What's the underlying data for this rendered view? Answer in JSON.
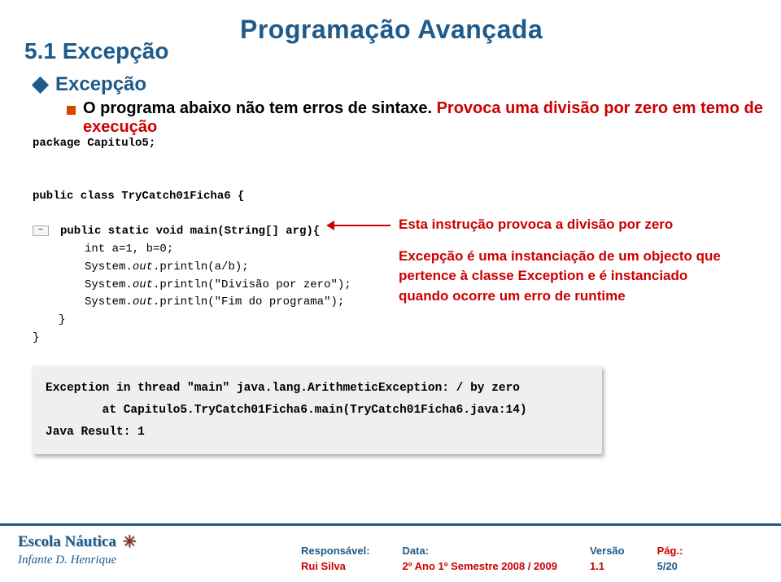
{
  "header": {
    "main_title": "Programação Avançada",
    "section_title": "5.1 Excepção",
    "sub_title": "Excepção",
    "body_part1": "O programa abaixo não tem erros de sintaxe. ",
    "body_part2": "Provoca uma divisão por zero em temo de execução"
  },
  "code": {
    "l1": "package Capitulo5;",
    "l2": "",
    "l3": "",
    "l4": "public class TryCatch01Ficha6 {",
    "l5": "",
    "l6": "public static void main(String[] arg){",
    "l7": "int a=1, b=0;",
    "l8": "System.out.println(a/b);",
    "l9": "System.out.println(\"Divisão por zero\");",
    "l10": "System.out.println(\"Fim do programa\");",
    "l11": "}",
    "l12": "}",
    "system": "System",
    "out_italic": "out",
    "gutter_symbol": "−"
  },
  "annotation": {
    "line1": "Esta instrução provoca a divisão por zero",
    "line2": "Excepção é uma instanciação de um objecto que pertence à classe Exception e é instanciado quando ocorre um erro de runtime"
  },
  "console": {
    "l1": "Exception in thread \"main\" java.lang.ArithmeticException: / by zero",
    "l2": "        at Capitulo5.TryCatch01Ficha6.main(TryCatch01Ficha6.java:14)",
    "l3": "Java Result: 1"
  },
  "footer": {
    "school": "Escola Náutica",
    "infante": "Infante D. Henrique",
    "cols": {
      "resp_label": "Responsável:",
      "resp_val": "Rui Silva",
      "data_label": "Data:",
      "data_val": "2º Ano 1º Semestre 2008 / 2009",
      "versao_label": "Versão",
      "versao_val": "1.1",
      "pag_label": "Pág.:",
      "pag_val": "5/20"
    }
  }
}
